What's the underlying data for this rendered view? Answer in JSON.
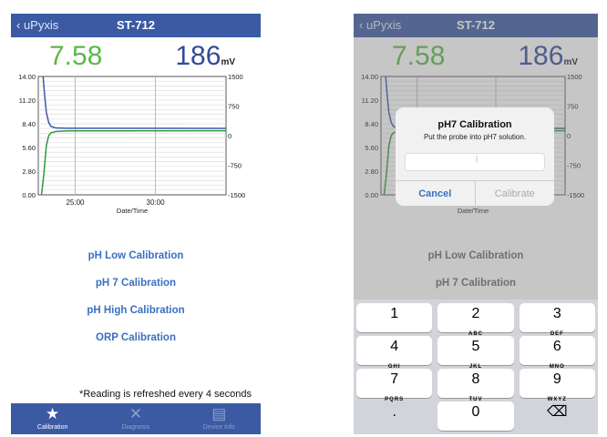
{
  "nav": {
    "back_label": "uPyxis",
    "title": "ST-712"
  },
  "readings": {
    "ph": "7.58",
    "mv": "186",
    "mv_unit": "mV"
  },
  "calibration_buttons": [
    "pH Low Calibration",
    "pH 7 Calibration",
    "pH High Calibration",
    "ORP Calibration"
  ],
  "note": "*Reading is refreshed every 4 seconds",
  "tabs": [
    {
      "label": "Calibration",
      "icon": "star-icon"
    },
    {
      "label": "Diagnosis",
      "icon": "tools-icon"
    },
    {
      "label": "Device Info",
      "icon": "document-icon"
    }
  ],
  "dialog": {
    "title": "pH7 Calibration",
    "message": "Put the probe into pH7 solution.",
    "input_value": "",
    "cancel": "Cancel",
    "confirm": "Calibrate"
  },
  "keyboard": [
    [
      {
        "n": "1",
        "l": ""
      },
      {
        "n": "2",
        "l": "ABC"
      },
      {
        "n": "3",
        "l": "DEF"
      }
    ],
    [
      {
        "n": "4",
        "l": "GHI"
      },
      {
        "n": "5",
        "l": "JKL"
      },
      {
        "n": "6",
        "l": "MNO"
      }
    ],
    [
      {
        "n": "7",
        "l": "PQRS"
      },
      {
        "n": "8",
        "l": "TUV"
      },
      {
        "n": "9",
        "l": "WXYZ"
      }
    ],
    [
      {
        "n": ".",
        "l": ""
      },
      {
        "n": "0",
        "l": ""
      },
      {
        "n": "⌫",
        "l": ""
      }
    ]
  ],
  "colors": {
    "ph": "#5cb848",
    "mv": "#334a9a",
    "nav": "#3b5aa3",
    "ph_line": "#2e9a3e",
    "mv_line": "#3f55b0"
  },
  "chart_data": {
    "type": "line",
    "xlabel": "Date/Time",
    "x_ticks": [
      "25:00",
      "30:00"
    ],
    "x_tick_values": [
      25,
      30
    ],
    "xlim": [
      22.7,
      34.4
    ],
    "left_axis": {
      "ticks": [
        "14.00",
        "11.20",
        "8.40",
        "5.60",
        "2.80",
        "0.00"
      ],
      "ylim": [
        0,
        14
      ]
    },
    "right_axis": {
      "ticks": [
        "1500",
        "750",
        "0",
        "-750",
        "-1500"
      ],
      "ylim": [
        -1500,
        1500
      ]
    },
    "series": [
      {
        "name": "pH",
        "axis": "left",
        "x": [
          22.9,
          23.05,
          23.2,
          23.35,
          23.5,
          23.8,
          24.5,
          34.4
        ],
        "y": [
          0,
          2.5,
          5.8,
          7.0,
          7.35,
          7.5,
          7.56,
          7.58
        ]
      },
      {
        "name": "mV",
        "axis": "right",
        "x": [
          23.0,
          23.1,
          23.2,
          23.35,
          23.5,
          23.8,
          24.5,
          34.4
        ],
        "y": [
          1500,
          1000,
          600,
          330,
          230,
          195,
          188,
          186
        ]
      }
    ]
  }
}
